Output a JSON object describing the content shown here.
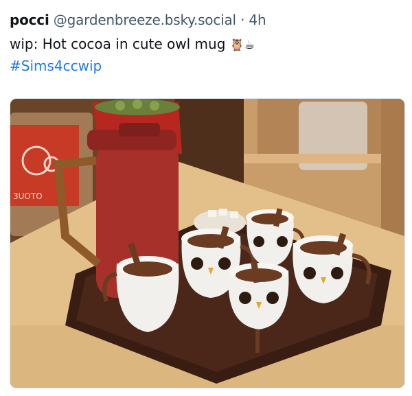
{
  "post": {
    "display_name": "pocci",
    "handle": "@gardenbreeze.bsky.social",
    "separator": "·",
    "time": "4h",
    "text": "wip: Hot cocoa in cute owl mug",
    "emojis": "🦉☕",
    "hashtag": "#Sims4ccwip"
  },
  "image": {
    "description_icon": "photo-image",
    "sign_text": "3UOTO",
    "colors": {
      "counter": "#e9c994",
      "wall": "#7a5232",
      "tray": "#3a1d12",
      "pitcher": "#a8302a",
      "mug": "#f2f0ec",
      "cocoa": "#6b3b22",
      "shelf": "#c89d6a"
    }
  }
}
